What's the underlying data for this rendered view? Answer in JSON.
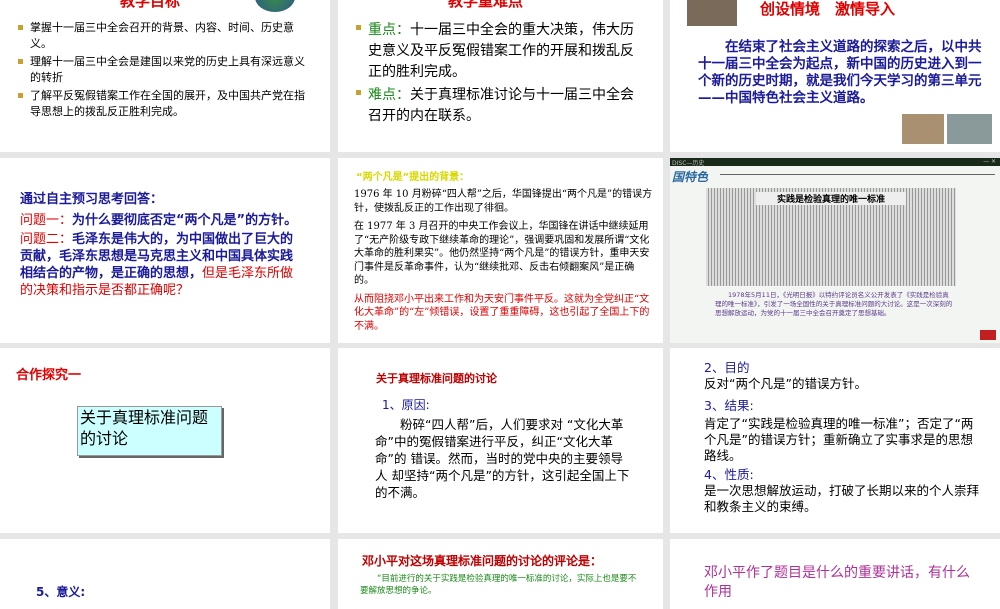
{
  "slides": {
    "s1": {
      "title": "教学目标",
      "bullets": [
        "掌握十一届三中全会召开的背景、内容、时间、历史意义。",
        "理解十一届三中全会是建国以来党的历史上具有深远意义的转折",
        "了解平反冤假错案工作在全国的展开，及中国共产党在指导思想上的拨乱反正胜利完成。"
      ]
    },
    "s2": {
      "title": "教学重难点",
      "items": [
        {
          "label": "重点：",
          "text": "十一届三中全会的重大决策，伟大历史意义及平反冤假错案工作的开展和拨乱反正的胜利完成。"
        },
        {
          "label": "难点：",
          "text": "关于真理标准讨论与十一届三中全会召开的内在联系。"
        }
      ]
    },
    "s3": {
      "title": "创设情境　激情导入",
      "body": "在结束了社会主义道路的探索之后，以中共十一届三中全会为起点，新中国的历史进入到一个新的历史时期，就是我们今天学习的第三单元——中国特色社会主义道路。"
    },
    "s4": {
      "heading": "通过自主预习思考回答：",
      "q1_label": "问题一：",
      "q1": "为什么要彻底否定“两个凡是”的方针。",
      "q2_label": "问题二：",
      "q2": "毛泽东是伟大的，为中国做出了巨大的贡献，毛泽东思想是马克思主义和中国具体实践相结合的产物，是正确的思想，",
      "q2_red": "但是毛泽东所做的决策和指示是否都正确呢？"
    },
    "s5": {
      "title": "“两个凡是”提出的背景：",
      "p1": "1976 年 10 月粉碎“四人帮”之后，华国锋提出“两个凡是”的错误方针，使拨乱反正的工作出现了徘徊。",
      "p2": "在 1977 年 3 月召开的中央工作会议上，华国锋在讲话中继续延用了“无产阶级专政下继续革命的理论”，强调要巩固和发展所谓“文化大革命的胜利果实”。他仍然坚持“两个凡是”的错误方针，重申天安门事件是反革命事件，认为“继续批邓、反击右倾翻案风”是正确的。",
      "p3": "从而阻挠邓小平出来工作和为天安门事件平反。这就为全党纠正“文化大革命”的“左”倾错误，设置了重重障碍，这也引起了全国上下的不满。"
    },
    "s6": {
      "window_title": "DISC—历史",
      "banner": "国特色",
      "headline": "实践是检验真理的唯一标准",
      "caption": "1978年5月11日，《光明日报》以特约评论员名义公开发表了《实践是检验真理的唯一标准》，引发了一场全国性的关于真理标准问题的大讨论。这是一次深刻的思想解放运动，为党的十一届三中全会召开奠定了思想基础。"
    },
    "s7": {
      "title": "合作探究一",
      "box": "关于真理标准问题的讨论"
    },
    "s8": {
      "title": "关于真理标准问题的讨论",
      "sub": "1、原因:",
      "body": "粉碎“四人帮”后，人们要求对 “文化大革命”中的冤假错案进行平反，纠正“文化大革命”的 错误。然而，当时的党中央的主要领导人 却坚持“两个凡是”的方针，这引起全国上下的不满。"
    },
    "s9": {
      "h2": "2、目的",
      "t2": "反对“两个凡是”的错误方针。",
      "h3": "3、结果:",
      "t3": "肯定了“实践是检验真理的唯一标准”；否定了“两个凡是”的错误方针；重新确立了实事求是的思想路线。",
      "h4": "4、性质:",
      "t4": "是一次思想解放运动，打破了长期以来的个人崇拜和教条主义的束缚。"
    },
    "s10": {
      "text": "5、意义:"
    },
    "s11": {
      "title": "邓小平对这场真理标准问题的讨论的评论是：",
      "quote": "“目前进行的关于实践是检验真理的唯一标准的讨论，实际上也是要不要解放思想的争论。"
    },
    "s12": {
      "text": "邓小平作了题目是什么的重要讲话，有什么作用"
    }
  }
}
